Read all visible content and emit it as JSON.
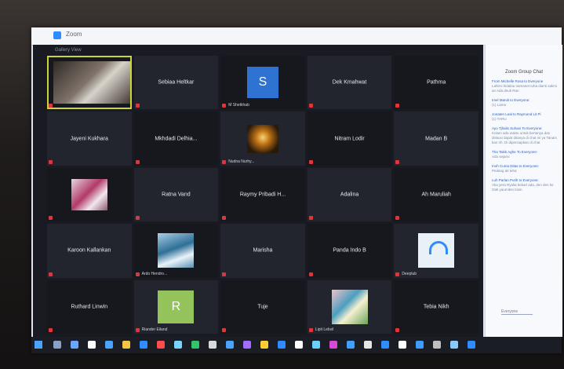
{
  "app": {
    "title": "Zoom"
  },
  "meeting": {
    "view_label": "Gallery View"
  },
  "tiles": [
    {
      "kind": "photo1",
      "name": "",
      "caption": "",
      "active": true
    },
    {
      "kind": "name",
      "name": "Sebiaa Heltkar",
      "caption": ""
    },
    {
      "kind": "letter",
      "letter": "S",
      "caption": "M Shetkhab"
    },
    {
      "kind": "name",
      "name": "Dek Kmahwat",
      "caption": ""
    },
    {
      "kind": "name",
      "name": "Pathma",
      "caption": ""
    },
    {
      "kind": "name",
      "name": "Jayeni Kukhara",
      "caption": ""
    },
    {
      "kind": "name",
      "name": "Mkhdadi Delhia...",
      "caption": ""
    },
    {
      "kind": "candle",
      "caption": "Nudna Nurhy..."
    },
    {
      "kind": "name",
      "name": "Nitram Lodir",
      "caption": ""
    },
    {
      "kind": "name",
      "name": "Madan B",
      "caption": ""
    },
    {
      "kind": "flower",
      "caption": ""
    },
    {
      "kind": "name",
      "name": "Ratna Vand",
      "caption": ""
    },
    {
      "kind": "name",
      "name": "Raymy Pribadi H...",
      "caption": ""
    },
    {
      "kind": "name",
      "name": "Adalina",
      "caption": ""
    },
    {
      "kind": "name",
      "name": "Ah Maruliah",
      "caption": ""
    },
    {
      "kind": "name",
      "name": "Karoon Kallankan",
      "caption": ""
    },
    {
      "kind": "sky",
      "caption": "Ardo Hendro..."
    },
    {
      "kind": "name",
      "name": "Marisha",
      "caption": ""
    },
    {
      "kind": "name",
      "name": "Panda Indo B",
      "caption": ""
    },
    {
      "kind": "logo",
      "caption": "Deeplub"
    },
    {
      "kind": "name",
      "name": "Ruthard Linwin",
      "caption": ""
    },
    {
      "kind": "letterR",
      "letter": "R",
      "caption": "Riander Eiland"
    },
    {
      "kind": "name",
      "name": "Tuje",
      "caption": ""
    },
    {
      "kind": "colorful",
      "caption": "Lipit Lebvil"
    },
    {
      "kind": "name",
      "name": "Tebia Nikh",
      "caption": ""
    }
  ],
  "side_panel": {
    "title": "Zoom Group Chat",
    "messages": [
      {
        "from": "From Michelle Rosa to Everyone",
        "body": "Lahirni hidabiu namanet tuha dianti sakmi an Ada deuk Ran"
      },
      {
        "from": "Imel Maruli to Everyone:",
        "body": "(1) Lama"
      },
      {
        "from": "Jonaten Leal to Raymond Lit Pi",
        "body": "(1) TARU"
      },
      {
        "from": "Ayo Tjhalis Suhani To Everyone:",
        "body": "Kolam ada waktu untuk bertanya dan diskusi dapat ditanya di chat ini ya Tanam kan rih. Di dipersiapkan di chat"
      },
      {
        "from": "Tha Takiti Aghe To Everyone:",
        "body": "Ada sejarni"
      },
      {
        "from": "Inoh Cuma Ditas to Everyone:",
        "body": "Pedang ati teha"
      },
      {
        "from": "Luh Parlan Putih to Everyone:",
        "body": "Aka yera Ryalia bekarl ada, den den ke Oak yaurniten bisin"
      }
    ],
    "input_placeholder": "Everyone"
  }
}
